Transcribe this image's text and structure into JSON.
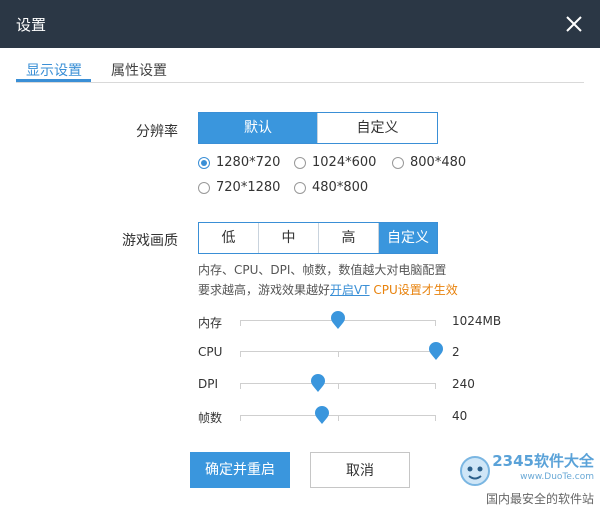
{
  "window": {
    "title": "设置"
  },
  "tabs": [
    {
      "label": "显示设置",
      "active": true
    },
    {
      "label": "属性设置",
      "active": false
    }
  ],
  "resolution": {
    "label": "分辨率",
    "modes": [
      {
        "label": "默认",
        "selected": true
      },
      {
        "label": "自定义",
        "selected": false
      }
    ],
    "options": [
      {
        "label": "1280*720",
        "checked": true
      },
      {
        "label": "1024*600",
        "checked": false
      },
      {
        "label": "800*480",
        "checked": false
      },
      {
        "label": "720*1280",
        "checked": false
      },
      {
        "label": "480*800",
        "checked": false
      }
    ]
  },
  "quality": {
    "label": "游戏画质",
    "levels": [
      {
        "label": "低",
        "selected": false
      },
      {
        "label": "中",
        "selected": false
      },
      {
        "label": "高",
        "selected": false
      },
      {
        "label": "自定义",
        "selected": true
      }
    ],
    "desc_line1": "内存、CPU、DPI、帧数，数值越大对电脑配置",
    "desc_line2_prefix": "要求越高，游戏效果越好",
    "desc_link": "开启VT",
    "desc_suffix": "CPU设置才生效"
  },
  "sliders": [
    {
      "label": "内存",
      "value": "1024MB",
      "fraction": 0.5
    },
    {
      "label": "CPU",
      "value": "2",
      "fraction": 1.0
    },
    {
      "label": "DPI",
      "value": "240",
      "fraction": 0.4
    },
    {
      "label": "帧数",
      "value": "40",
      "fraction": 0.42
    }
  ],
  "buttons": {
    "confirm": "确定并重启",
    "cancel": "取消"
  },
  "watermark": {
    "logo": "2345软件大全",
    "site": "www.DuoTe.com",
    "slogan": "国内最安全的软件站"
  },
  "colors": {
    "accent": "#3a96dd",
    "titlebar": "#2b3745",
    "link_orange": "#e8820c"
  }
}
